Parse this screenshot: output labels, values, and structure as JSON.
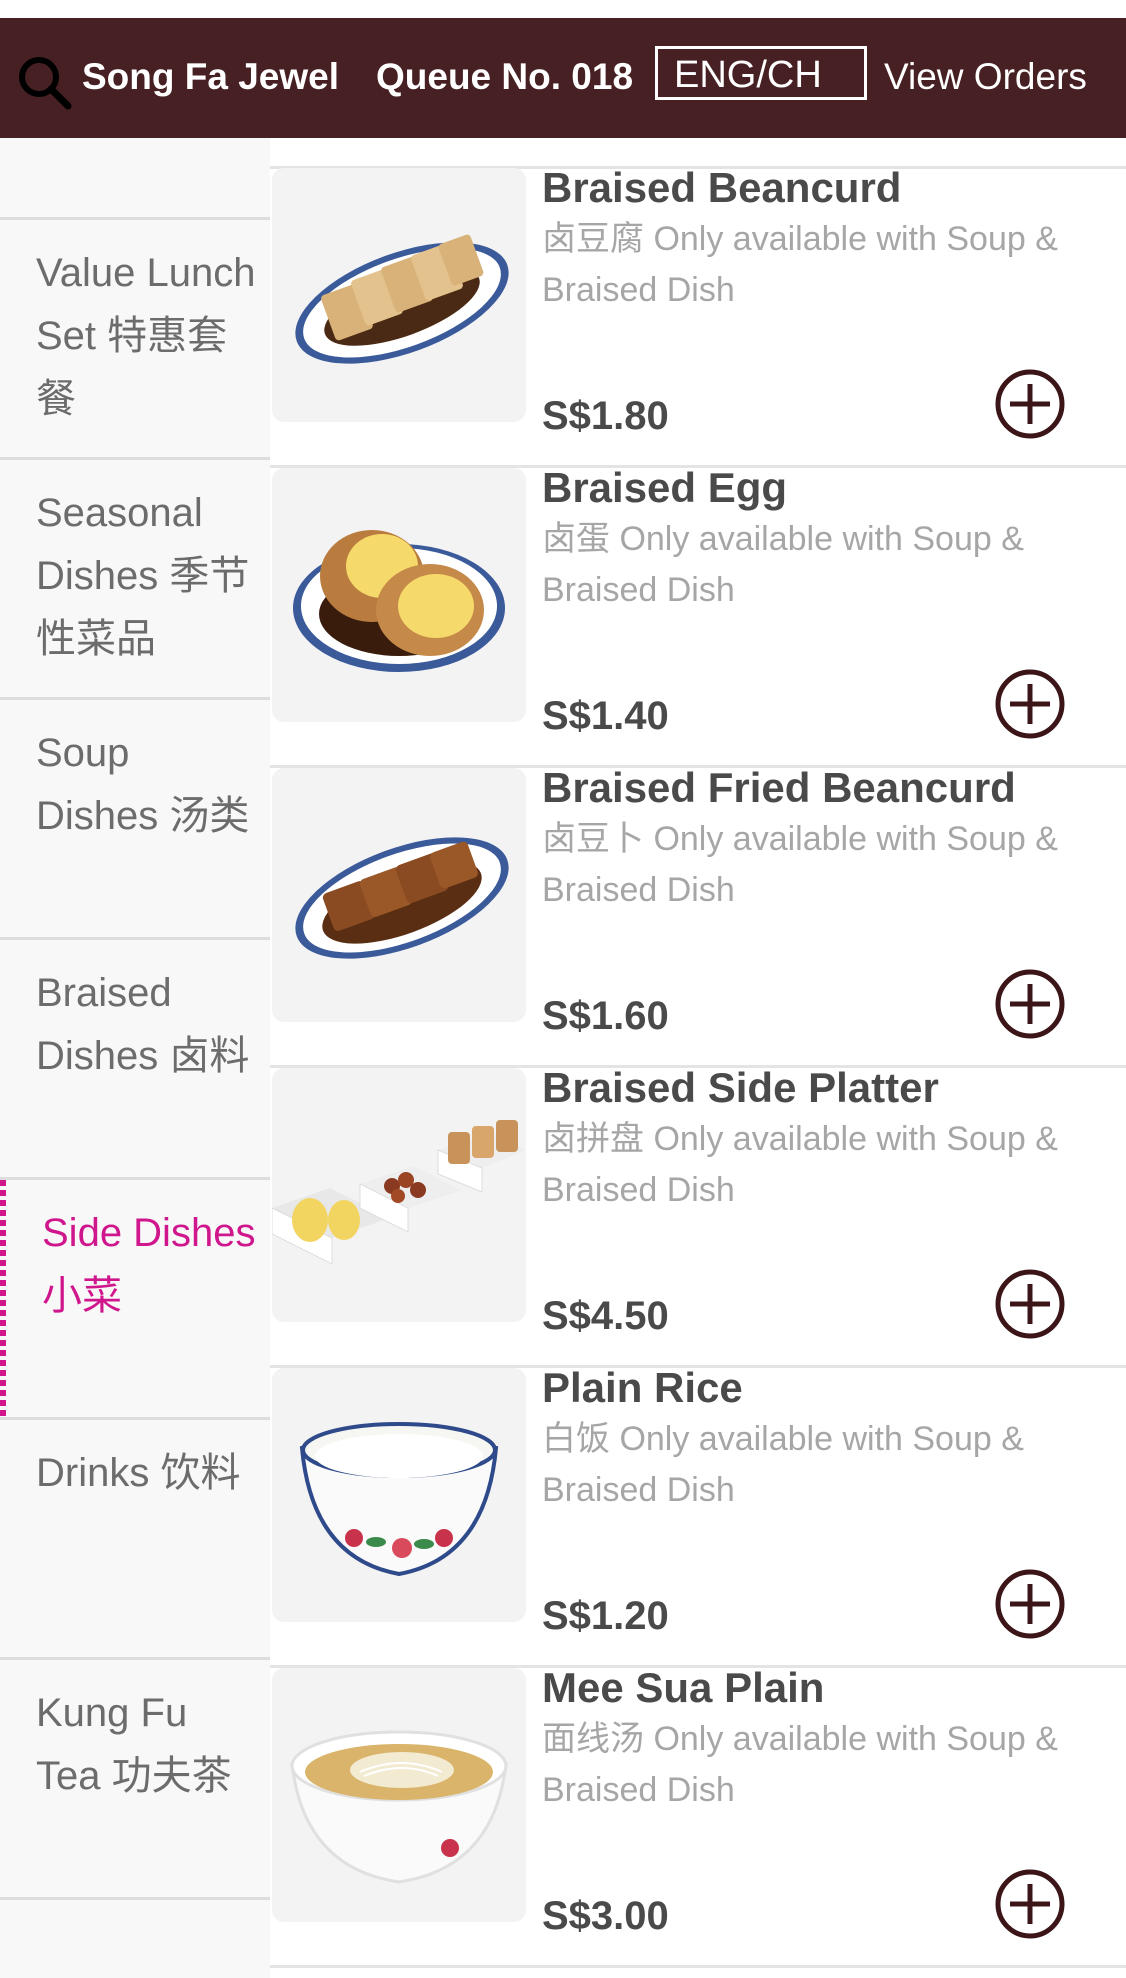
{
  "header": {
    "store_name": "Song Fa Jewel",
    "queue_label": "Queue No. 018",
    "language_toggle": "ENG/CH",
    "view_orders": "View Orders",
    "search_icon": "search-icon",
    "background_color": "#472023"
  },
  "sidebar": {
    "categories": [
      {
        "label": "Value Lunch Set 特惠套餐"
      },
      {
        "label": "Seasonal Dishes 季节性菜品"
      },
      {
        "label": "Soup Dishes 汤类"
      },
      {
        "label": "Braised Dishes 卤料"
      },
      {
        "label": "Side Dishes 小菜"
      },
      {
        "label": "Drinks 饮料"
      },
      {
        "label": "Kung Fu Tea 功夫茶"
      }
    ],
    "active_category": "Side Dishes 小菜",
    "active_color": "#d0168c"
  },
  "items": [
    {
      "name": "Braised Beancurd",
      "description": "卤豆腐 Only available with Soup & Braised Dish",
      "price": "S$1.80"
    },
    {
      "name": "Braised Egg",
      "description": "卤蛋 Only available with Soup & Braised Dish",
      "price": "S$1.40"
    },
    {
      "name": "Braised Fried Beancurd",
      "description": "卤豆卜 Only available with Soup & Braised Dish",
      "price": "S$1.60"
    },
    {
      "name": "Braised Side Platter",
      "description": "卤拼盘 Only available with Soup & Braised Dish",
      "price": "S$4.50"
    },
    {
      "name": "Plain Rice",
      "description": "白饭 Only available with Soup & Braised Dish",
      "price": "S$1.20"
    },
    {
      "name": "Mee Sua Plain",
      "description": "面线汤 Only available with Soup & Braised Dish",
      "price": "S$3.00"
    }
  ],
  "add_icon": "plus-circle-icon"
}
